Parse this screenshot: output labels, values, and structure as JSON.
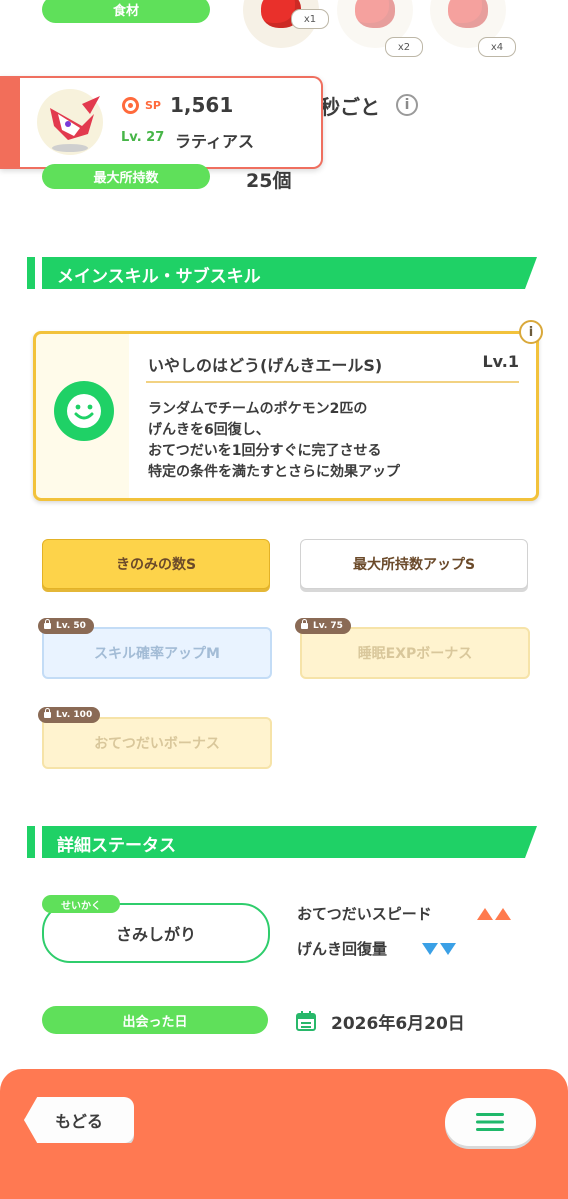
{
  "ingredients": {
    "label": "食材",
    "multipliers": [
      "x1",
      "x2",
      "x4"
    ]
  },
  "popup": {
    "sp_label": "SP",
    "sp_value": "1,561",
    "level": "Lv. 27",
    "name": "ラティアス"
  },
  "help_time": {
    "suffix": "秒ごと"
  },
  "max_carry": {
    "label": "最大所持数",
    "value": "25個"
  },
  "skills_section": {
    "title": "メインスキル・サブスキル",
    "main_skill": {
      "name": "いやしのはどう(げんきエールS)",
      "level": "Lv.1",
      "description": [
        "ランダムでチームのポケモン2匹の",
        "げんきを6回復し、",
        "おてつだいを1回分すぐに完了させる",
        "特定の条件を満たすとさらに効果アップ"
      ]
    },
    "sub_skills": [
      {
        "label": "きのみの数S"
      },
      {
        "label": "最大所持数アップS"
      },
      {
        "label": "スキル確率アップM",
        "lock": "Lv. 50"
      },
      {
        "label": "睡眠EXPボーナス",
        "lock": "Lv. 75"
      },
      {
        "label": "おてつだいボーナス",
        "lock": "Lv. 100"
      }
    ]
  },
  "details_section": {
    "title": "詳細ステータス",
    "nature_tag": "せいかく",
    "nature": "さみしがり",
    "stat_up": "おてつだいスピード",
    "stat_down": "げんき回復量",
    "met_label": "出会った日",
    "met_date": "2026年6月20日"
  },
  "footer": {
    "back_label": "もどる"
  },
  "colors": {
    "green": "#1fd166",
    "pill_green": "#5fe05a",
    "gold": "#f2c23b",
    "coral": "#ff7952",
    "up_arrow": "#ff7a4d",
    "down_arrow": "#3aa0e6"
  }
}
